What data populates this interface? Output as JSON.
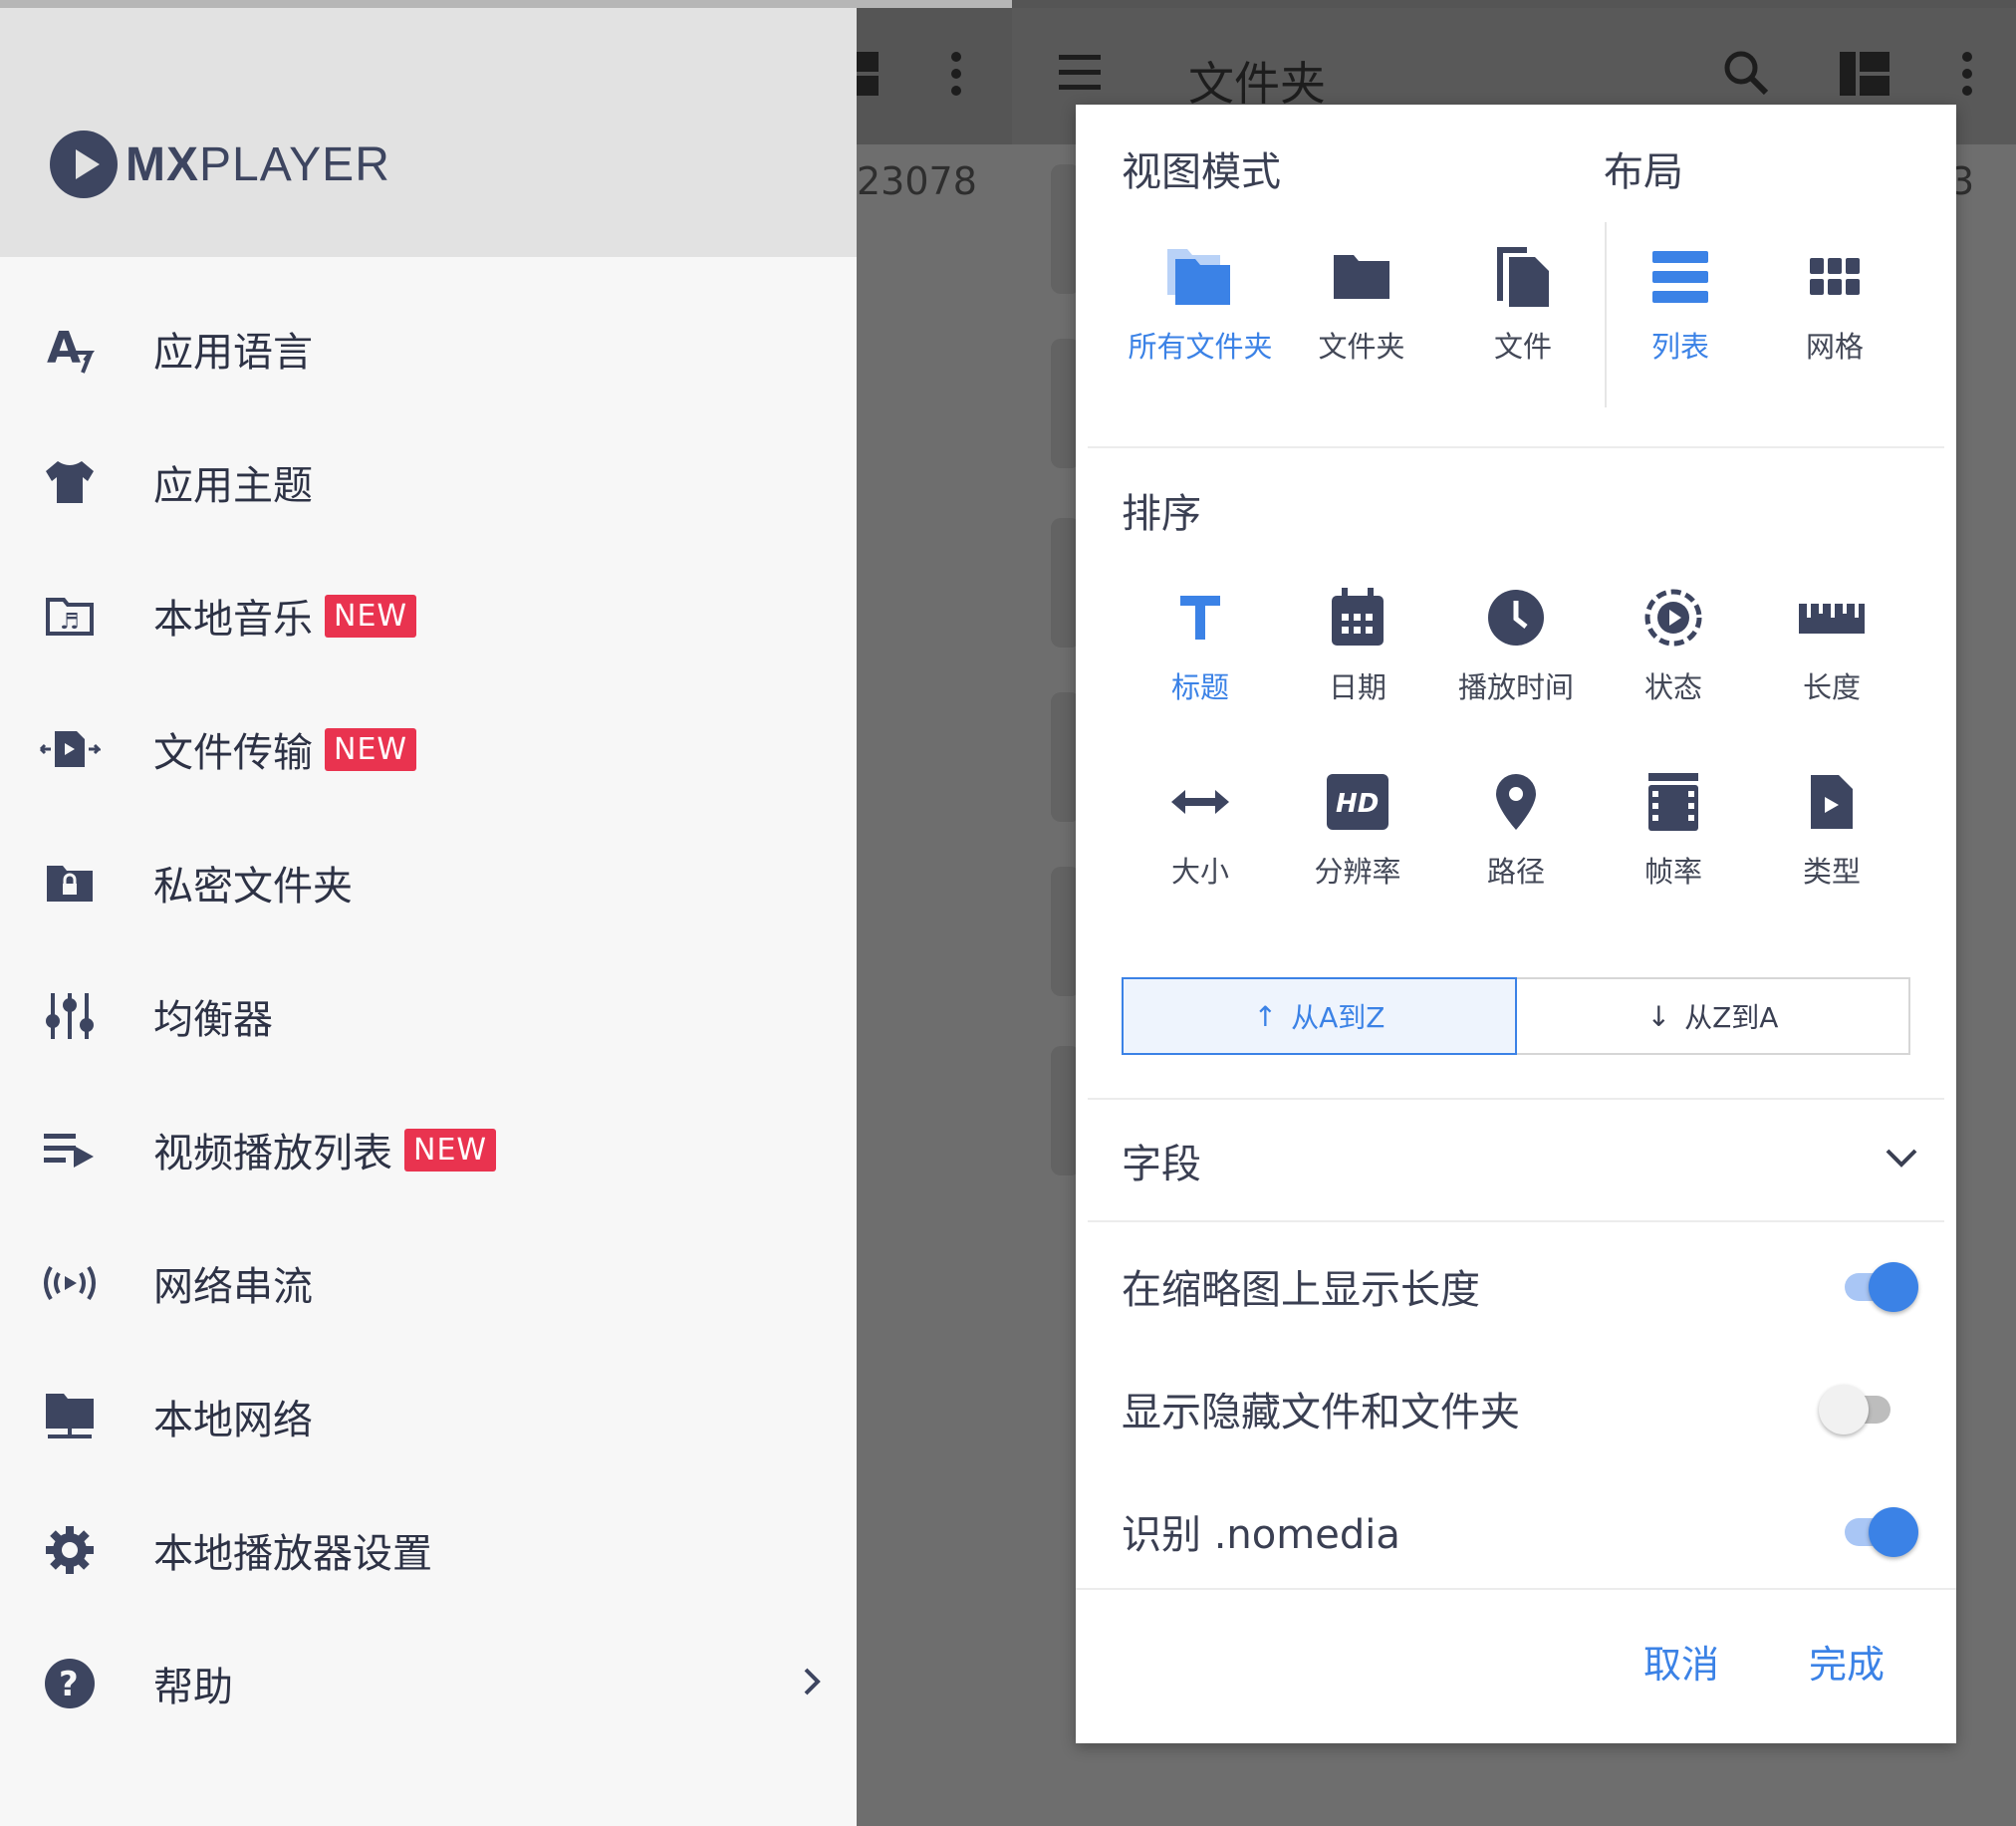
{
  "drawer": {
    "logo": {
      "brand_bold": "MX",
      "brand_light": "PLAYER"
    },
    "items": [
      {
        "label": "应用语言",
        "icon": "language-icon",
        "new": false
      },
      {
        "label": "应用主题",
        "icon": "tshirt-icon",
        "new": false
      },
      {
        "label": "本地音乐",
        "icon": "music-folder-icon",
        "new": true
      },
      {
        "label": "文件传输",
        "icon": "file-transfer-icon",
        "new": true
      },
      {
        "label": "私密文件夹",
        "icon": "lock-folder-icon",
        "new": false
      },
      {
        "label": "均衡器",
        "icon": "equalizer-icon",
        "new": false
      },
      {
        "label": "视频播放列表",
        "icon": "playlist-icon",
        "new": true
      },
      {
        "label": "网络串流",
        "icon": "stream-icon",
        "new": false
      },
      {
        "label": "本地网络",
        "icon": "local-network-icon",
        "new": false
      },
      {
        "label": "本地播放器设置",
        "icon": "gear-icon",
        "new": false
      },
      {
        "label": "帮助",
        "icon": "help-icon",
        "new": false
      }
    ],
    "new_badge": "NEW"
  },
  "background": {
    "title": "文件夹",
    "number_left": "23078",
    "number_right": "3"
  },
  "dialog": {
    "view_mode_title": "视图模式",
    "layout_title": "布局",
    "view_modes": [
      {
        "label": "所有文件夹",
        "active": true
      },
      {
        "label": "文件夹",
        "active": false
      },
      {
        "label": "文件",
        "active": false
      }
    ],
    "layouts": [
      {
        "label": "列表",
        "active": true
      },
      {
        "label": "网格",
        "active": false
      }
    ],
    "sort_title": "排序",
    "sort_options": [
      {
        "label": "标题",
        "active": true
      },
      {
        "label": "日期",
        "active": false
      },
      {
        "label": "播放时间",
        "active": false
      },
      {
        "label": "状态",
        "active": false
      },
      {
        "label": "长度",
        "active": false
      },
      {
        "label": "大小",
        "active": false
      },
      {
        "label": "分辨率",
        "active": false
      },
      {
        "label": "路径",
        "active": false
      },
      {
        "label": "帧率",
        "active": false
      },
      {
        "label": "类型",
        "active": false
      }
    ],
    "order": {
      "asc": "从A到Z",
      "desc": "从Z到A",
      "selected": "asc"
    },
    "fields_title": "字段",
    "toggles": [
      {
        "label": "在缩略图上显示长度",
        "on": true
      },
      {
        "label": "显示隐藏文件和文件夹",
        "on": false
      },
      {
        "label": "识别 .nomedia",
        "on": true
      }
    ],
    "cancel": "取消",
    "done": "完成"
  },
  "colors": {
    "accent": "#3b82e6",
    "icon": "#3d4560",
    "badge": "#e9334f"
  }
}
